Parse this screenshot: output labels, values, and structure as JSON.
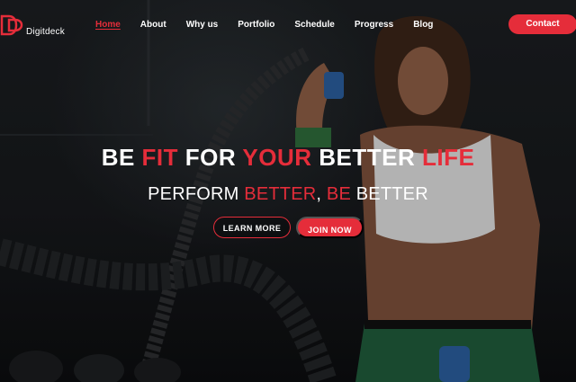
{
  "brand": {
    "name": "Digitdeck",
    "logo_icon": "logo-icon",
    "accent": "#e52d3a"
  },
  "nav": {
    "items": [
      {
        "label": "Home",
        "active": true
      },
      {
        "label": "About"
      },
      {
        "label": "Why us"
      },
      {
        "label": "Portfolio"
      },
      {
        "label": "Schedule"
      },
      {
        "label": "Progress"
      },
      {
        "label": "Blog"
      }
    ]
  },
  "contact_label": "Contact",
  "hero": {
    "headline": {
      "part1": "BE ",
      "part2": "FIT",
      "part3": " FOR ",
      "part4": "YOUR",
      "part5": " BETTER ",
      "part6": "LIFE"
    },
    "subline": {
      "part1": "PERFORM ",
      "part2": "BETTER",
      "part3": ", ",
      "part4": "BE",
      "part5": " BETTER"
    },
    "learn_more": "LEARN MORE",
    "join_now": "JOIN NOW"
  }
}
